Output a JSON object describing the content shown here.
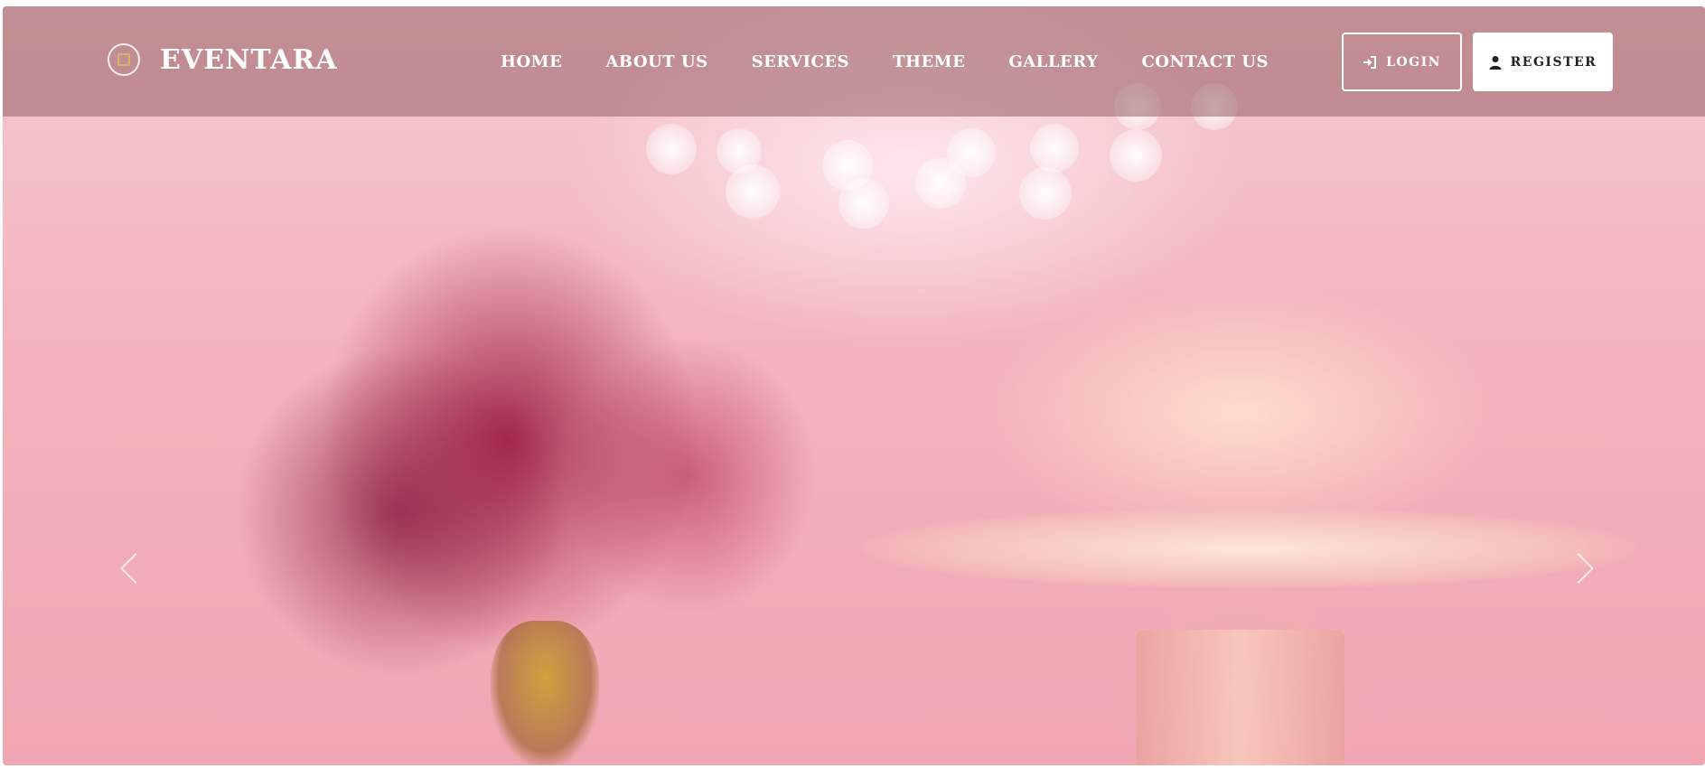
{
  "brand": {
    "name": "EVENTARA"
  },
  "nav": {
    "links": [
      "HOME",
      "ABOUT US",
      "SERVICES",
      "THEME",
      "GALLERY",
      "CONTACT US"
    ]
  },
  "auth": {
    "login_label": "LOGIN",
    "register_label": "REGISTER"
  },
  "icons": {
    "logo": "logo-ring-icon",
    "login": "sign-in-icon",
    "register": "user-icon",
    "prev": "chevron-left-icon",
    "next": "chevron-right-icon"
  },
  "colors": {
    "navbar_overlay": "#965f62",
    "hero_pink": "#f2a6b2",
    "logo_accent": "#d7b36a"
  },
  "hero": {
    "image_subject": "pink rose-frosted cake on a cake stand beside a floral arrangement"
  }
}
